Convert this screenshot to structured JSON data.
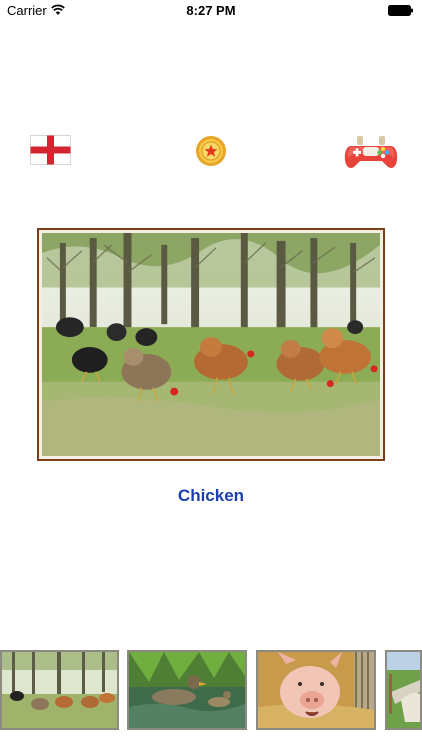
{
  "status_bar": {
    "carrier": "Carrier",
    "time": "8:27 PM"
  },
  "toolbar": {
    "language_icon": "england-flag-icon",
    "coin_icon": "star-coin-icon",
    "game_icon": "gamepad-icon"
  },
  "main": {
    "animal_name": "Chicken",
    "name_color": "#1b3fae"
  },
  "thumbnails": [
    {
      "icon": "chicken-thumbnail"
    },
    {
      "icon": "duck-thumbnail"
    },
    {
      "icon": "pig-thumbnail"
    },
    {
      "icon": "horse-thumbnail"
    }
  ]
}
